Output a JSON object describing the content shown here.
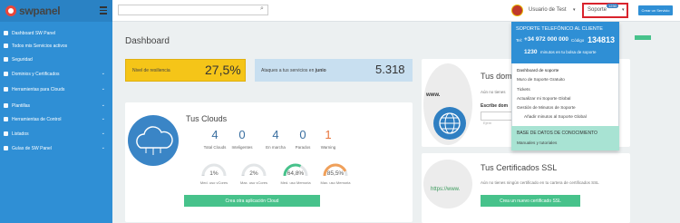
{
  "brand": {
    "name": "swpanel"
  },
  "sidebar": {
    "items": [
      {
        "label": "Dashboard SW Panel",
        "chev": ""
      },
      {
        "label": "Todos mis Servicios activos",
        "chev": ""
      },
      {
        "label": "Seguridad",
        "chev": ""
      },
      {
        "label": "Dominios y Certificados",
        "chev": "⌄"
      },
      {
        "label": "Herramientas para Clouds",
        "chev": "⌄"
      },
      {
        "label": "Plantillas",
        "chev": "⌄"
      },
      {
        "label": "Herramientas de Control",
        "chev": "⌄"
      },
      {
        "label": "Listados",
        "chev": "⌄"
      },
      {
        "label": "Guías de SW Panel",
        "chev": "⌄"
      }
    ]
  },
  "topbar": {
    "user": "Usuario de Test",
    "soporte": "Soporte",
    "soporte_badge": "1230",
    "servicio_button": "Crear un Servicio"
  },
  "dashboard": {
    "title": "Dashboard",
    "resiliencia": {
      "label": "Nivel de resiliencia",
      "value": "27,5%"
    },
    "ataques": {
      "label": "Ataques a tus servicios en",
      "month": "junio",
      "value": "5.318"
    },
    "clouds": {
      "title": "Tus Clouds",
      "stats": [
        {
          "value": "4",
          "label": "Total Clouds",
          "color": "#3a6fa0"
        },
        {
          "value": "0",
          "label": "Inteligentes",
          "color": "#3a6fa0"
        },
        {
          "value": "4",
          "label": "En marcha",
          "color": "#3a6fa0"
        },
        {
          "value": "0",
          "label": "Parados",
          "color": "#3a6fa0"
        },
        {
          "value": "1",
          "label": "Warning",
          "color": "#e8743b"
        }
      ],
      "gauges": [
        {
          "value": "1%",
          "label": "Med. uso vCores",
          "pct": 0.01,
          "color": "#cfd3d6"
        },
        {
          "value": "2%",
          "label": "Max. uso vCores",
          "pct": 0.02,
          "color": "#cfd3d6"
        },
        {
          "value": "64,8%",
          "label": "Med. uso Memoria",
          "pct": 0.648,
          "color": "#47c28b"
        },
        {
          "value": "85,5%",
          "label": "Max. uso Memoria",
          "pct": 0.855,
          "color": "#f0a05a"
        }
      ],
      "button": "Crea otra aplicación Cloud"
    },
    "dominios": {
      "title": "Tus domi",
      "subtitle": "Aún no tienes",
      "www": "www.",
      "search_label": "Escribe dom",
      "input_placeholder": "Ejem"
    },
    "ssl": {
      "title": "Tus Certificados SSL",
      "subtitle": "Aún no tienes ningún certificado en tu cartera de certificados SSL",
      "www": "https://www.",
      "button": "Crea un nuevo certificado SSL"
    }
  },
  "support_dropdown": {
    "tel_title": "SOPORTE TELEFÓNICO AL CLIENTE",
    "tel_prefix": "Tel:",
    "tel": "+34 972 000 000",
    "codigo_label": "Código",
    "codigo": "134813",
    "minutes": "1230",
    "minutes_label": "minutos en tu bolsa de soporte",
    "links": [
      "Dashboard de soporte",
      "Muro de Soporte Gratuito",
      "Tickets",
      "Actualizar mi Soporte Global",
      "Gestión de Minutos de Soporte",
      "Añadir minutos al Soporte Global"
    ],
    "base_title": "BASE DE DATOS DE CONOCIMIENTO",
    "base_link": "Manuales y tutoriales"
  },
  "colors": {
    "sidebar": "#2f8fd5",
    "resiliencia": "#f5c518",
    "ataques": "#c8dff0",
    "green": "#47c28b",
    "alert_border": "#d9232d"
  }
}
